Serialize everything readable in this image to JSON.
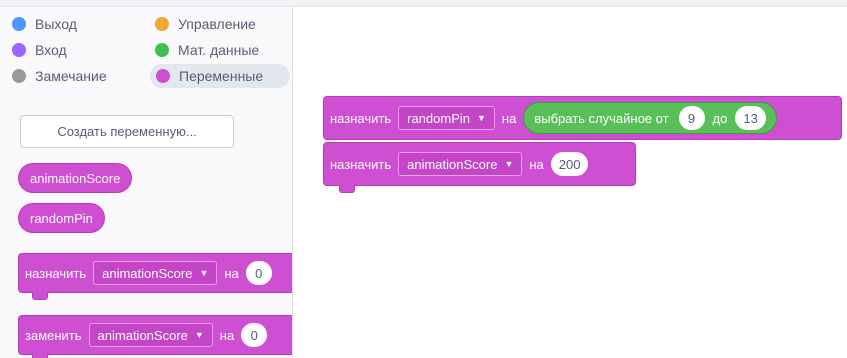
{
  "categories": [
    {
      "label": "Выход",
      "color": "#4c97ff",
      "icon": "category-dot-icon"
    },
    {
      "label": "Управление",
      "color": "#f0a633",
      "icon": "category-dot-icon"
    },
    {
      "label": "Вход",
      "color": "#9966ff",
      "icon": "category-dot-icon"
    },
    {
      "label": "Мат. данные",
      "color": "#40bf4a",
      "icon": "category-dot-icon"
    },
    {
      "label": "Замечание",
      "color": "#9a9a9a",
      "icon": "category-dot-icon"
    },
    {
      "label": "Переменные",
      "color": "#cf4fd2",
      "icon": "category-dot-icon",
      "active": true
    }
  ],
  "palette": {
    "make_variable": "Создать переменную...",
    "variables": [
      "animationScore",
      "randomPin"
    ],
    "set_block": {
      "keyword": "назначить",
      "variable": "animationScore",
      "to": "на",
      "value": "0"
    },
    "change_block": {
      "keyword": "заменить",
      "variable": "animationScore",
      "by": "на",
      "value": "0"
    }
  },
  "workspace": {
    "block1": {
      "keyword": "назначить",
      "variable": "randomPin",
      "to": "на",
      "random": {
        "label": "выбрать случайное от",
        "from": "9",
        "and": "до",
        "to": "13"
      }
    },
    "block2": {
      "keyword": "назначить",
      "variable": "animationScore",
      "to": "на",
      "value": "200"
    }
  },
  "colors": {
    "variables": "#cf4fd2",
    "math": "#59c059"
  }
}
